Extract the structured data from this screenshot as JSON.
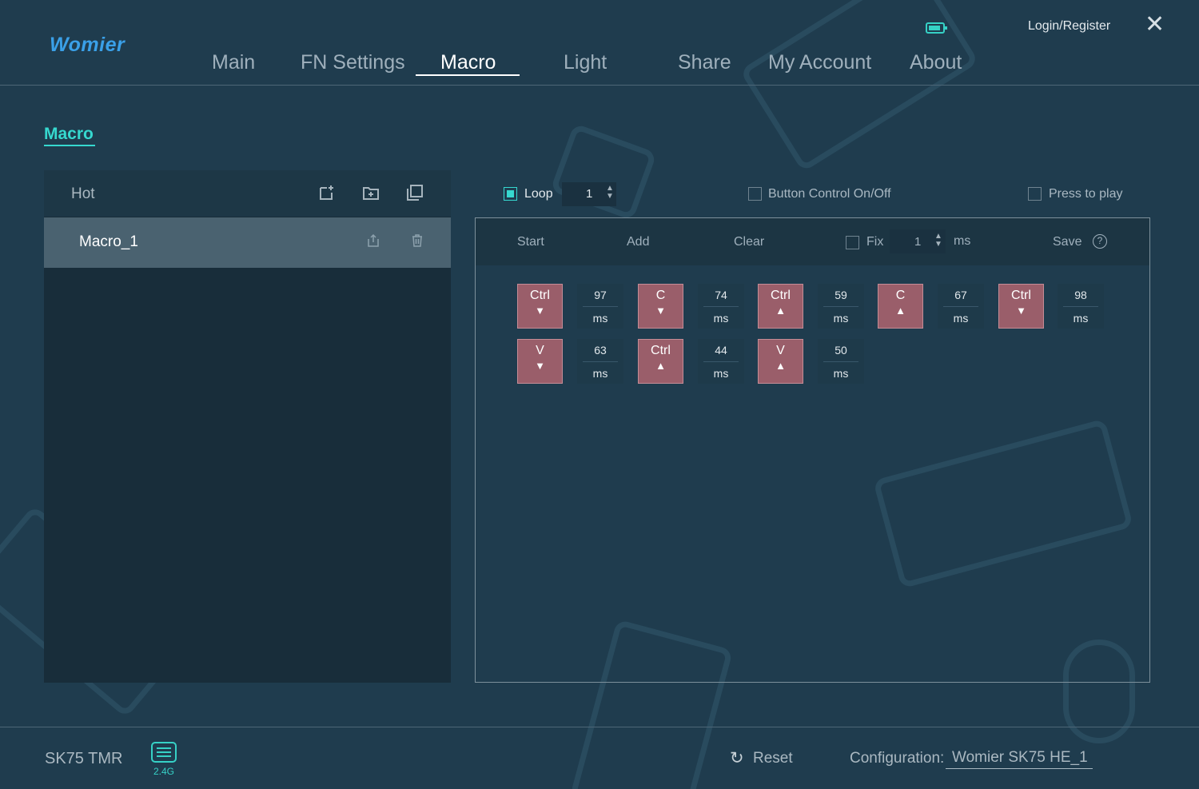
{
  "app": {
    "logo": "Womier",
    "login": "Login/Register",
    "close_glyph": "✕",
    "battery_icon": "battery-icon"
  },
  "nav": {
    "main": "Main",
    "fn": "FN Settings",
    "macro": "Macro",
    "light": "Light",
    "share": "Share",
    "account": "My Account",
    "about": "About"
  },
  "section": {
    "title": "Macro"
  },
  "macro_list": {
    "header": "Hot",
    "items": [
      {
        "name": "Macro_1"
      }
    ]
  },
  "controls": {
    "loop_label": "Loop",
    "loop_checked": true,
    "loop_value": "1",
    "button_control_label": "Button Control On/Off",
    "press_to_play_label": "Press to play"
  },
  "toolbar": {
    "start": "Start",
    "add": "Add",
    "clear": "Clear",
    "fix": "Fix",
    "fix_value": "1",
    "fix_unit": "ms",
    "save": "Save",
    "help": "?"
  },
  "events": [
    {
      "key": "Ctrl",
      "dir": "▼",
      "delay": "97",
      "unit": "ms"
    },
    {
      "key": "C",
      "dir": "▼",
      "delay": "74",
      "unit": "ms"
    },
    {
      "key": "Ctrl",
      "dir": "▲",
      "delay": "59",
      "unit": "ms"
    },
    {
      "key": "C",
      "dir": "▲",
      "delay": "67",
      "unit": "ms"
    },
    {
      "key": "Ctrl",
      "dir": "▼",
      "delay": "98",
      "unit": "ms"
    },
    {
      "key": "V",
      "dir": "▼",
      "delay": "63",
      "unit": "ms"
    },
    {
      "key": "Ctrl",
      "dir": "▲",
      "delay": "44",
      "unit": "ms"
    },
    {
      "key": "V",
      "dir": "▲",
      "delay": "50",
      "unit": "ms"
    }
  ],
  "footer": {
    "device": "SK75 TMR",
    "connection": "2.4G",
    "reset_glyph": "↻",
    "reset": "Reset",
    "config_label": "Configuration:",
    "config_value": "Womier SK75 HE_1"
  },
  "colors": {
    "accent": "#36d8cf",
    "background": "#1f3c4e",
    "key_fill": "#9a5e6a"
  }
}
